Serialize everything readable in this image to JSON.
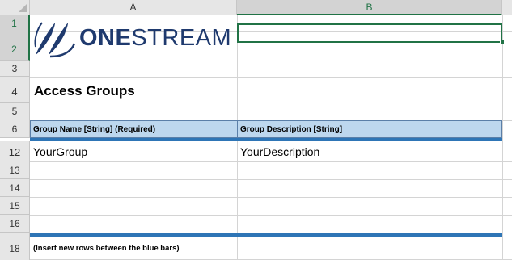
{
  "columns": [
    "A",
    "B"
  ],
  "rows": [
    "1",
    "2",
    "3",
    "4",
    "5",
    "6",
    "12",
    "13",
    "14",
    "15",
    "16",
    "18"
  ],
  "logo": {
    "part1": "ONE",
    "part2": "STREAM",
    "brand_color": "#1f3a6e"
  },
  "cells": {
    "title": "Access Groups",
    "header_a": "Group Name  [String] (Required)",
    "header_b": "Group Description  [String]",
    "row12_a": "YourGroup",
    "row12_b": "YourDescription",
    "row18_a": "(Insert new rows between the blue bars)"
  },
  "colors": {
    "accent": "#217346",
    "header_fill": "#bdd7ee",
    "blue_bar": "#2e75b6"
  }
}
